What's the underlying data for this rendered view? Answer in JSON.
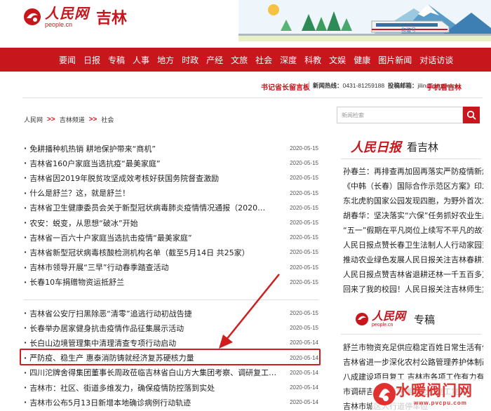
{
  "header": {
    "logo_cn": "人民网",
    "logo_en": "people.cn",
    "site_name": "吉林",
    "banner_tag": "和谐号"
  },
  "nav": [
    "要闻",
    "日报",
    "专稿",
    "人事",
    "地方",
    "时政",
    "产经",
    "文旅",
    "社会",
    "深度",
    "科教",
    "文娱",
    "健康",
    "图片新闻",
    "对话访谈"
  ],
  "subbar": {
    "left_link": "书记省长留言板",
    "hotline_label": "新闻热线：",
    "hotline": "0431-81259188",
    "email_label": "投稿邮箱：",
    "email": "jilin@people.cn",
    "right_link": "手机看吉林"
  },
  "breadcrumb": [
    "人民网",
    "吉林频道",
    "社会"
  ],
  "news_group1": [
    {
      "title": "免耕播种机热销 耕地保护带来“商机”",
      "date": "2020-05-15"
    },
    {
      "title": "吉林省160户家庭当选抗疫“最美家庭”",
      "date": "2020-05-15"
    },
    {
      "title": "吉林省因2019年脱贫攻坚成效考核好获国务院督查激励",
      "date": "2020-05-15"
    },
    {
      "title": "什么是舒兰？这，就是舒兰！",
      "date": "2020-05-15"
    },
    {
      "title": "吉林省卫生健康委员会关于新型冠状病毒肺炎疫情情况通报（2020…",
      "date": "2020-05-15"
    },
    {
      "title": "农安：蜕变，从思想“破冰”开始",
      "date": "2020-05-15"
    },
    {
      "title": "吉林省一百六十户家庭当选抗击疫情“最美家庭”",
      "date": "2020-05-15"
    },
    {
      "title": "吉林省新型冠状病毒核酸检测机构名单（截至5月14日 共25家）",
      "date": "2020-05-15"
    },
    {
      "title": "吉林市领导开展“三早”行动春季踏查活动",
      "date": "2020-05-15"
    },
    {
      "title": "长春10车捐赠物资运抵舒兰",
      "date": "2020-05-15"
    }
  ],
  "news_group2": [
    {
      "title": "吉林省公安厅扫黑除恶“清零”追逃行动初战告捷",
      "date": "2020-05-15"
    },
    {
      "title": "长春举办居家健身抗击疫情作品征集展示活动",
      "date": "2020-05-15"
    },
    {
      "title": "长白山边境管理集中清理清查专项行动启动",
      "date": "2020-05-14"
    },
    {
      "title": "严防疫、稳生产 惠泰消防铸就经济复苏硬核力量",
      "date": "2020-05-14"
    },
    {
      "title": "四川沱牌舍得集团董事长周政莅临吉林省白山方大集团考察、调研复工…",
      "date": "2020-05-14"
    },
    {
      "title": "吉林市：社区、街道多维发力，确保疫情防控落到实处",
      "date": "2020-05-14"
    },
    {
      "title": "吉林市公布5月13日新增本地确诊病例行动轨迹",
      "date": "2020-05-14"
    }
  ],
  "search": {
    "placeholder": "新闻检索"
  },
  "sidebar1": {
    "brand": "人民日报",
    "title": "看吉林",
    "lines": [
      "孙春兰：再排查再加固再落实严防疫情新燃点",
      "《中韩（长春）国际合作示范区方案》印发",
      "东北虎豹国家公园发现四胞，为野外首次发现",
      "胡春华：坚决落实“六保”任务抓好农业生产",
      "“五一”假期在平凡岗位上续写不平凡的故事",
      "人民日报点赞长春卫生法制人人行动家园更美",
      "推动农业绿色发展人民日报关注吉林春耕工作",
      "人民日报点赞吉林省退耕还林一千五百多万亩",
      "回来了我的校园！人民日报关注吉林师生复课"
    ]
  },
  "sidebar2": {
    "brand": "人民网",
    "brand_en": "people.cn",
    "title": "专稿",
    "lines": [
      "舒兰市物资充足供应稳定百姓日常生活有保障",
      "吉林省进一步深化农村公路管理养护体制改革",
      "八成建设项目复工 吉林市各项工作有力有序推进",
      "市调研吉林市有序推进全面复工复产",
      "吉林市城区人行道停车位"
    ]
  },
  "watermark": {
    "text": "水暖阀门网",
    "url": "www.pvcpu.com"
  },
  "colors": {
    "brand_red": "#c8161d",
    "highlight_red": "#d01e1e"
  }
}
